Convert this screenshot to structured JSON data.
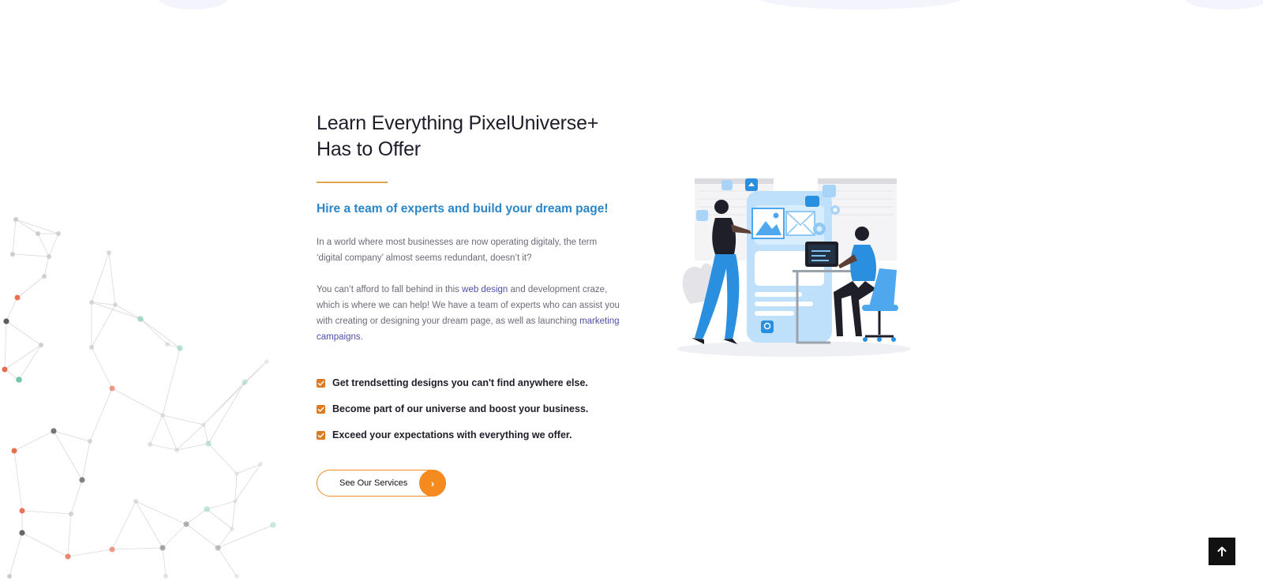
{
  "section": {
    "headline_line1": "Learn Everything PixelUniverse+",
    "headline_line2": "Has to Offer",
    "subheading": "Hire a team of experts and build your dream page!",
    "intro_paragraph": "In a world where most businesses are now operating digitaly, the term ‘digital company’ almost seems redundant, doesn’t it?",
    "body": {
      "part1": "You can’t afford to fall behind in this ",
      "link1": "web design",
      "part2": " and development craze, which is where we can help! We have a team of experts who can assist you with creating or designing your dream page, as well as launching ",
      "link2": "marketing campaigns",
      "part3": "."
    },
    "features": [
      "Get trendsetting designs you can't find anywhere else.",
      "Become part of our universe and boost your business.",
      "Exceed your expectations with everything we offer."
    ],
    "cta_label": "See Our Services",
    "cta_icon": "chevron-right-icon"
  },
  "illustration": {
    "icon": "team-web-design-illustration"
  },
  "back_to_top": {
    "icon": "arrow-up-icon"
  },
  "colors": {
    "accent_orange": "#f58a1f",
    "checkbox_orange": "#e07a1f",
    "subheading_blue": "#2a86c9",
    "link_purple": "#4f4fa8",
    "divider_gold": "#e0a44a",
    "illustration_blue": "#4fa8ee"
  }
}
